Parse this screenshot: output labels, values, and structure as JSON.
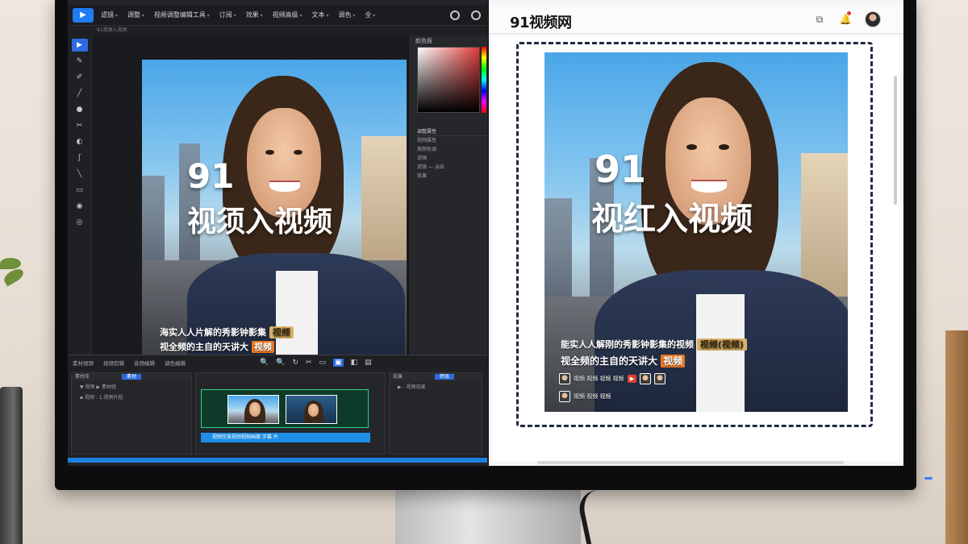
{
  "editor": {
    "menu": [
      "滤镜",
      "调整",
      "视频调整编辑工具",
      "订阅",
      "效果",
      "视频高级",
      "文本",
      "调色",
      "全"
    ],
    "subbar": "91视频入视频",
    "tools": [
      "▶",
      "✎",
      "✐",
      "╱",
      "●",
      "✂",
      "◐",
      "ʃ",
      "╲",
      "▭",
      "◉",
      "◎"
    ],
    "canvas": {
      "overlay_number": "91",
      "overlay_title": "视须入视频",
      "caption_line1": "海实人人片解的秀影钟影集",
      "caption_line1_tag": "视频",
      "caption_line2": "视全频的主自的天讲大",
      "caption_line2_tag": "视频"
    },
    "right_panel": {
      "color_title": "颜色板",
      "props": [
        "调整属性",
        "视频属性",
        "美颜色调",
        "滤镜",
        "滤镜 — 淡出",
        "效果"
      ]
    },
    "timeline_tabs": [
      "素材视频",
      "视频剪辑",
      "音频编辑",
      "调色编辑"
    ],
    "timeline_icons": [
      "🔍",
      "🔍",
      "↻",
      "✂",
      "▭",
      "▣",
      "◧",
      "▤"
    ],
    "media_panel": {
      "title": "素材库",
      "tab": "素材",
      "rows": [
        "▼ 视频  ▶ 素材组",
        "▪ 视频  : 1.视频片段"
      ]
    },
    "effects_panel": {
      "title": "效果",
      "tab": "特效",
      "rows": [
        "▶  : 视频效果"
      ]
    },
    "subtitle_track": "视频完美视频视频画面  字幕  片"
  },
  "web": {
    "logo": "91视频网",
    "icons": [
      "share-icon",
      "bell-icon",
      "avatar"
    ],
    "preview": {
      "overlay_number": "91",
      "overlay_title": "视红入视频",
      "caption_line1": "能实人人解刚的秀影钟影集的视频",
      "caption_line1_tag": "视频(视频)",
      "caption_line2": "视全频的主自的天讲大",
      "caption_line2_tag": "视频",
      "meta_row1": "视频 视频 视频 视频",
      "meta_row2": "视频 视频 视频"
    }
  }
}
